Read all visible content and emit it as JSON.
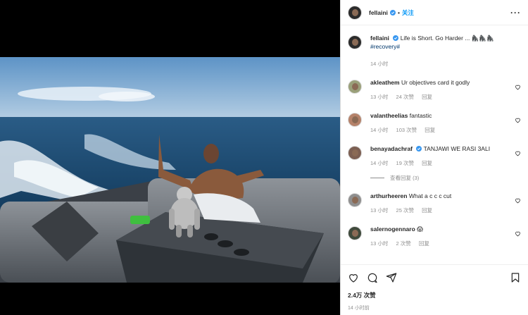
{
  "post": {
    "username": "fellaini",
    "follow_label": "关注",
    "more_label": "···",
    "caption_text": "Life is Short. Go Harder ... 🦍🦍🦍",
    "caption_hashtag": "#recovery#",
    "caption_time": "14 小时"
  },
  "comments": [
    {
      "username": "akleathem",
      "text": "Ur objectives card it godly",
      "time": "13 小时",
      "likes": "24 次赞",
      "reply": "回复"
    },
    {
      "username": "valantheelias",
      "text": "fantastic",
      "time": "14 小时",
      "likes": "103 次赞",
      "reply": "回复"
    },
    {
      "username": "benayadachraf",
      "text": "TANJAWI WE RASI 3ALI",
      "time": "14 小时",
      "likes": "19 次赞",
      "reply": "回复",
      "view_replies": "查看回复 (3)"
    },
    {
      "username": "arthurheeren",
      "text": "What a c c c cut",
      "time": "13 小时",
      "likes": "25 次赞",
      "reply": "回复"
    },
    {
      "username": "salernogennaro",
      "text": "😱",
      "time": "13 小时",
      "likes": "2 次赞",
      "reply": "回复"
    }
  ],
  "footer": {
    "likes_count": "2.4万 次赞",
    "post_time": "14 小时前"
  },
  "colors": {
    "accent": "#0095f6",
    "hashtag": "#00376b",
    "muted": "#8e8e8e",
    "verified": "#3897f0"
  },
  "icons": [
    "heart-icon",
    "comment-icon",
    "share-icon",
    "bookmark-icon",
    "verified-badge-icon",
    "more-options-icon"
  ]
}
